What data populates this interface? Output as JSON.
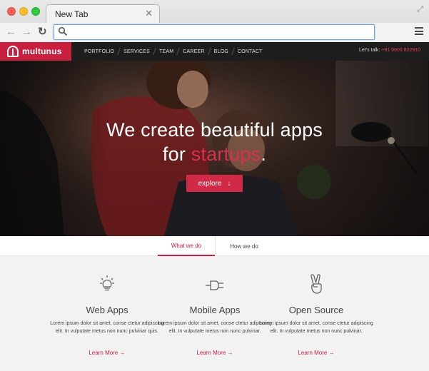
{
  "browser": {
    "tab_title": "New Tab",
    "tab_close_icon": "close-icon",
    "address_value": "",
    "back_icon": "arrow-left-icon",
    "forward_icon": "arrow-right-icon",
    "reload_icon": "reload-icon",
    "search_icon": "search-icon",
    "menu_icon": "hamburger-menu-icon",
    "fullscreen_icon": "fullscreen-icon"
  },
  "site": {
    "logo_text": "multunus",
    "menu": [
      "PORTFOLIO",
      "SERVICES",
      "TEAM",
      "CAREER",
      "BLOG",
      "CONTACT"
    ],
    "talk_label": "Let's talk: ",
    "phone": "+91 9900 822910"
  },
  "hero": {
    "line1": "We create beautiful apps",
    "line2_prefix": "for ",
    "line2_accent": "startups",
    "line2_suffix": ".",
    "cta_label": "explore",
    "cta_icon": "↓"
  },
  "tabs": [
    {
      "label": "What we do",
      "active": true
    },
    {
      "label": "How we do",
      "active": false
    }
  ],
  "services": [
    {
      "icon": "lightbulb-icon",
      "title": "Web Apps",
      "desc": "Lorem ipsum dolor sit amet, conse ctetur adipiscing elit. In vulputate metus non nunc pulvinar quis.",
      "link": "Learn More →"
    },
    {
      "icon": "plug-icon",
      "title": "Mobile Apps",
      "desc": "Lorem ipsum dolor sit amet, conse ctetur adipiscing elit. In vulputate metus non nunc pulvinar.",
      "link": "Learn More →"
    },
    {
      "icon": "peace-hand-icon",
      "title": "Open Source",
      "desc": "Lorem ipsum dolor sit amet, conse ctetur adipiscing elit. In vulputate metus non nunc pulvinar.",
      "link": "Learn More →"
    }
  ],
  "colors": {
    "brand": "#c8213f",
    "nav_bg": "#1d1d1d",
    "section_bg": "#f2f2f2"
  }
}
